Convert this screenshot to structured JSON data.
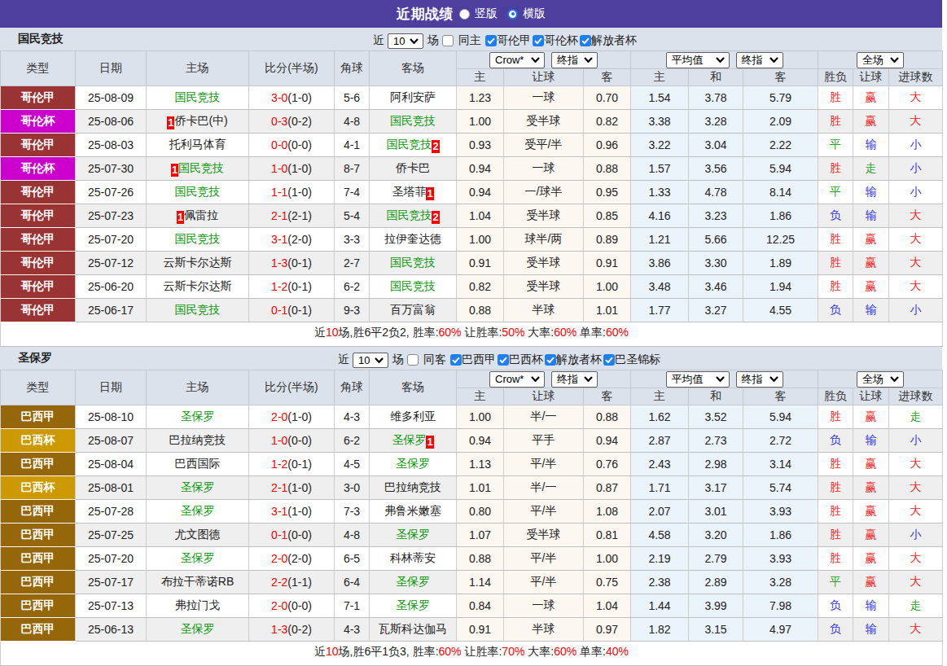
{
  "topbar": {
    "title": "近期战绩",
    "radios": [
      {
        "label": "竖版",
        "checked": false
      },
      {
        "label": "横版",
        "checked": true
      }
    ]
  },
  "colors": {
    "topbar_bg": "#4e3f9e",
    "bar_bg": "#dbe2ec",
    "header_bg": "#dbe2ec",
    "row_alt_bg": "#efefef",
    "odds_bg": "#fcf7f0",
    "avg_bg": "#ebf4fa",
    "team_green": "#008000",
    "score_red": "#e60000",
    "result_red": "#ee3333",
    "result_blue": "#3333dd",
    "result_green": "#2e9e2e",
    "badge_red": "#ff0000",
    "checkbox_blue": "#1e80f0",
    "league_colors": {
      "哥伦甲": "#9a3334",
      "哥伦杯": "#cc00cc",
      "巴西甲": "#96660a",
      "巴西杯": "#cc9900"
    }
  },
  "table_headers": {
    "left": [
      "类型",
      "日期",
      "主场",
      "比分(半场)",
      "角球",
      "客场"
    ],
    "sub": [
      "主",
      "让球",
      "客",
      "主",
      "和",
      "客",
      "胜负",
      "让球",
      "进球数"
    ],
    "selects": {
      "company": "Crow*",
      "company_time": "终指",
      "average": "平均值",
      "average_time": "终指",
      "scope": "全场"
    }
  },
  "sections": [
    {
      "team": "国民竞技",
      "controls": {
        "near": "近",
        "count": "10",
        "games": "场",
        "same": {
          "label": "同主",
          "checked": false
        },
        "leagues": [
          {
            "label": "哥伦甲",
            "checked": true
          },
          {
            "label": "哥伦杯",
            "checked": true
          },
          {
            "label": "解放者杯",
            "checked": true
          }
        ]
      },
      "rows": [
        {
          "type": "哥伦甲",
          "date": "25-08-09",
          "home": {
            "text": "国民竞技",
            "green": true
          },
          "score": {
            "ft": "3-0",
            "ht": "(1-0)"
          },
          "corner": "5-6",
          "away": {
            "text": "阿利安萨",
            "green": false
          },
          "odds": [
            "1.23",
            "一球",
            "0.70"
          ],
          "avg": [
            "1.54",
            "3.78",
            "5.79"
          ],
          "results": [
            [
              "胜",
              "r"
            ],
            [
              "赢",
              "r"
            ],
            [
              "大",
              "r"
            ]
          ]
        },
        {
          "type": "哥伦杯",
          "date": "25-08-06",
          "home": {
            "text": "侨卡巴(中)",
            "green": false,
            "badge": "1",
            "badge_pos": "before"
          },
          "score": {
            "ft": "0-3",
            "ht": "(0-2)"
          },
          "corner": "4-8",
          "away": {
            "text": "国民竞技",
            "green": true
          },
          "odds": [
            "1.00",
            "受半球",
            "0.82"
          ],
          "avg": [
            "3.38",
            "3.28",
            "2.09"
          ],
          "results": [
            [
              "胜",
              "r"
            ],
            [
              "赢",
              "r"
            ],
            [
              "大",
              "r"
            ]
          ]
        },
        {
          "type": "哥伦甲",
          "date": "25-08-03",
          "home": {
            "text": "托利马体育",
            "green": false
          },
          "score": {
            "ft": "0-0",
            "ht": "(0-0)"
          },
          "corner": "4-1",
          "away": {
            "text": "国民竞技",
            "green": true,
            "badge": "2",
            "badge_pos": "after"
          },
          "odds": [
            "0.93",
            "受平/半",
            "0.96"
          ],
          "avg": [
            "3.22",
            "3.04",
            "2.22"
          ],
          "results": [
            [
              "平",
              "g"
            ],
            [
              "输",
              "b"
            ],
            [
              "小",
              "b"
            ]
          ]
        },
        {
          "type": "哥伦杯",
          "date": "25-07-30",
          "home": {
            "text": "国民竞技",
            "green": true,
            "badge": "1",
            "badge_pos": "before"
          },
          "score": {
            "ft": "1-0",
            "ht": "(1-0)"
          },
          "corner": "8-7",
          "away": {
            "text": "侨卡巴",
            "green": false
          },
          "odds": [
            "0.94",
            "一球",
            "0.88"
          ],
          "avg": [
            "1.57",
            "3.56",
            "5.94"
          ],
          "results": [
            [
              "胜",
              "r"
            ],
            [
              "走",
              "g"
            ],
            [
              "小",
              "b"
            ]
          ]
        },
        {
          "type": "哥伦甲",
          "date": "25-07-26",
          "home": {
            "text": "国民竞技",
            "green": true
          },
          "score": {
            "ft": "1-1",
            "ht": "(1-0)"
          },
          "corner": "7-4",
          "away": {
            "text": "圣塔菲",
            "green": false,
            "badge": "1",
            "badge_pos": "after"
          },
          "odds": [
            "0.94",
            "一/球半",
            "0.95"
          ],
          "avg": [
            "1.33",
            "4.78",
            "8.14"
          ],
          "results": [
            [
              "平",
              "g"
            ],
            [
              "输",
              "b"
            ],
            [
              "小",
              "b"
            ]
          ]
        },
        {
          "type": "哥伦甲",
          "date": "25-07-23",
          "home": {
            "text": "佩雷拉",
            "green": false,
            "badge": "1",
            "badge_pos": "before"
          },
          "score": {
            "ft": "2-1",
            "ht": "(2-1)"
          },
          "corner": "5-4",
          "away": {
            "text": "国民竞技",
            "green": true,
            "badge": "2",
            "badge_pos": "after"
          },
          "odds": [
            "1.04",
            "受半球",
            "0.85"
          ],
          "avg": [
            "4.16",
            "3.23",
            "1.86"
          ],
          "results": [
            [
              "负",
              "b"
            ],
            [
              "输",
              "b"
            ],
            [
              "大",
              "r"
            ]
          ]
        },
        {
          "type": "哥伦甲",
          "date": "25-07-20",
          "home": {
            "text": "国民竞技",
            "green": true
          },
          "score": {
            "ft": "3-1",
            "ht": "(2-0)"
          },
          "corner": "3-3",
          "away": {
            "text": "拉伊奎达德",
            "green": false
          },
          "odds": [
            "1.00",
            "球半/两",
            "0.89"
          ],
          "avg": [
            "1.21",
            "5.66",
            "12.25"
          ],
          "results": [
            [
              "胜",
              "r"
            ],
            [
              "赢",
              "r"
            ],
            [
              "大",
              "r"
            ]
          ]
        },
        {
          "type": "哥伦甲",
          "date": "25-07-12",
          "home": {
            "text": "云斯卡尔达斯",
            "green": false
          },
          "score": {
            "ft": "1-3",
            "ht": "(0-1)"
          },
          "corner": "2-7",
          "away": {
            "text": "国民竞技",
            "green": true
          },
          "odds": [
            "0.91",
            "受半球",
            "0.91"
          ],
          "avg": [
            "3.86",
            "3.30",
            "1.89"
          ],
          "results": [
            [
              "胜",
              "r"
            ],
            [
              "赢",
              "r"
            ],
            [
              "大",
              "r"
            ]
          ]
        },
        {
          "type": "哥伦甲",
          "date": "25-06-20",
          "home": {
            "text": "云斯卡尔达斯",
            "green": false
          },
          "score": {
            "ft": "1-2",
            "ht": "(0-1)"
          },
          "corner": "6-2",
          "away": {
            "text": "国民竞技",
            "green": true
          },
          "odds": [
            "0.82",
            "受半球",
            "1.00"
          ],
          "avg": [
            "3.48",
            "3.46",
            "1.94"
          ],
          "results": [
            [
              "胜",
              "r"
            ],
            [
              "赢",
              "r"
            ],
            [
              "大",
              "r"
            ]
          ]
        },
        {
          "type": "哥伦甲",
          "date": "25-06-17",
          "home": {
            "text": "国民竞技",
            "green": true
          },
          "score": {
            "ft": "0-1",
            "ht": "(0-1)"
          },
          "corner": "9-3",
          "away": {
            "text": "百万富翁",
            "green": false
          },
          "odds": [
            "0.88",
            "半球",
            "1.01"
          ],
          "avg": [
            "1.77",
            "3.27",
            "4.55"
          ],
          "results": [
            [
              "负",
              "b"
            ],
            [
              "输",
              "b"
            ],
            [
              "小",
              "b"
            ]
          ]
        }
      ],
      "summary": [
        {
          "text": "近",
          "c": "k"
        },
        {
          "text": "10",
          "c": "r"
        },
        {
          "text": "场,胜6平2负2, 胜率:",
          "c": "k"
        },
        {
          "text": "60%",
          "c": "r"
        },
        {
          "text": " 让胜率:",
          "c": "k"
        },
        {
          "text": "50%",
          "c": "r"
        },
        {
          "text": " 大率:",
          "c": "k"
        },
        {
          "text": "60%",
          "c": "r"
        },
        {
          "text": " 单率:",
          "c": "k"
        },
        {
          "text": "60%",
          "c": "r"
        }
      ]
    },
    {
      "team": "圣保罗",
      "controls": {
        "near": "近",
        "count": "10",
        "games": "场",
        "same": {
          "label": "同客",
          "checked": false
        },
        "leagues": [
          {
            "label": "巴西甲",
            "checked": true
          },
          {
            "label": "巴西杯",
            "checked": true
          },
          {
            "label": "解放者杯",
            "checked": true
          },
          {
            "label": "巴圣锦标",
            "checked": true
          }
        ]
      },
      "rows": [
        {
          "type": "巴西甲",
          "date": "25-08-10",
          "home": {
            "text": "圣保罗",
            "green": true
          },
          "score": {
            "ft": "2-0",
            "ht": "(1-0)"
          },
          "corner": "4-3",
          "away": {
            "text": "维多利亚",
            "green": false
          },
          "odds": [
            "1.00",
            "半/一",
            "0.88"
          ],
          "avg": [
            "1.62",
            "3.52",
            "5.94"
          ],
          "results": [
            [
              "胜",
              "r"
            ],
            [
              "赢",
              "r"
            ],
            [
              "走",
              "g"
            ]
          ]
        },
        {
          "type": "巴西杯",
          "date": "25-08-07",
          "home": {
            "text": "巴拉纳竞技",
            "green": false
          },
          "score": {
            "ft": "1-0",
            "ht": "(0-0)"
          },
          "corner": "6-2",
          "away": {
            "text": "圣保罗",
            "green": true,
            "badge": "1",
            "badge_pos": "after"
          },
          "odds": [
            "0.94",
            "平手",
            "0.94"
          ],
          "avg": [
            "2.87",
            "2.73",
            "2.72"
          ],
          "results": [
            [
              "负",
              "b"
            ],
            [
              "输",
              "b"
            ],
            [
              "小",
              "b"
            ]
          ]
        },
        {
          "type": "巴西甲",
          "date": "25-08-04",
          "home": {
            "text": "巴西国际",
            "green": false
          },
          "score": {
            "ft": "1-2",
            "ht": "(0-1)"
          },
          "corner": "4-5",
          "away": {
            "text": "圣保罗",
            "green": true
          },
          "odds": [
            "1.13",
            "平/半",
            "0.76"
          ],
          "avg": [
            "2.43",
            "2.98",
            "3.14"
          ],
          "results": [
            [
              "胜",
              "r"
            ],
            [
              "赢",
              "r"
            ],
            [
              "大",
              "r"
            ]
          ]
        },
        {
          "type": "巴西杯",
          "date": "25-08-01",
          "home": {
            "text": "圣保罗",
            "green": true
          },
          "score": {
            "ft": "2-1",
            "ht": "(1-0)"
          },
          "corner": "3-0",
          "away": {
            "text": "巴拉纳竞技",
            "green": false
          },
          "odds": [
            "1.01",
            "半/一",
            "0.87"
          ],
          "avg": [
            "1.71",
            "3.17",
            "5.74"
          ],
          "results": [
            [
              "胜",
              "r"
            ],
            [
              "赢",
              "r"
            ],
            [
              "大",
              "r"
            ]
          ]
        },
        {
          "type": "巴西甲",
          "date": "25-07-28",
          "home": {
            "text": "圣保罗",
            "green": true
          },
          "score": {
            "ft": "3-1",
            "ht": "(1-0)"
          },
          "corner": "7-3",
          "away": {
            "text": "弗鲁米嫩塞",
            "green": false
          },
          "odds": [
            "0.80",
            "平/半",
            "1.08"
          ],
          "avg": [
            "2.07",
            "3.01",
            "3.93"
          ],
          "results": [
            [
              "胜",
              "r"
            ],
            [
              "赢",
              "r"
            ],
            [
              "大",
              "r"
            ]
          ]
        },
        {
          "type": "巴西甲",
          "date": "25-07-25",
          "home": {
            "text": "尤文图德",
            "green": false
          },
          "score": {
            "ft": "0-1",
            "ht": "(0-0)"
          },
          "corner": "4-8",
          "away": {
            "text": "圣保罗",
            "green": true
          },
          "odds": [
            "1.07",
            "受半球",
            "0.81"
          ],
          "avg": [
            "4.58",
            "3.20",
            "1.86"
          ],
          "results": [
            [
              "胜",
              "r"
            ],
            [
              "赢",
              "r"
            ],
            [
              "小",
              "b"
            ]
          ]
        },
        {
          "type": "巴西甲",
          "date": "25-07-20",
          "home": {
            "text": "圣保罗",
            "green": true
          },
          "score": {
            "ft": "2-0",
            "ht": "(2-0)"
          },
          "corner": "6-5",
          "away": {
            "text": "科林蒂安",
            "green": false
          },
          "odds": [
            "0.88",
            "平/半",
            "1.00"
          ],
          "avg": [
            "2.19",
            "2.79",
            "3.93"
          ],
          "results": [
            [
              "胜",
              "r"
            ],
            [
              "赢",
              "r"
            ],
            [
              "大",
              "r"
            ]
          ]
        },
        {
          "type": "巴西甲",
          "date": "25-07-17",
          "home": {
            "text": "布拉干蒂诺RB",
            "green": false
          },
          "score": {
            "ft": "2-2",
            "ht": "(1-1)"
          },
          "corner": "6-4",
          "away": {
            "text": "圣保罗",
            "green": true
          },
          "odds": [
            "1.14",
            "平/半",
            "0.75"
          ],
          "avg": [
            "2.38",
            "2.89",
            "3.28"
          ],
          "results": [
            [
              "平",
              "g"
            ],
            [
              "赢",
              "r"
            ],
            [
              "大",
              "r"
            ]
          ]
        },
        {
          "type": "巴西甲",
          "date": "25-07-13",
          "home": {
            "text": "弗拉门戈",
            "green": false
          },
          "score": {
            "ft": "2-0",
            "ht": "(0-0)"
          },
          "corner": "7-1",
          "away": {
            "text": "圣保罗",
            "green": true
          },
          "odds": [
            "0.84",
            "一球",
            "1.04"
          ],
          "avg": [
            "1.44",
            "3.99",
            "7.98"
          ],
          "results": [
            [
              "负",
              "b"
            ],
            [
              "输",
              "b"
            ],
            [
              "走",
              "g"
            ]
          ]
        },
        {
          "type": "巴西甲",
          "date": "25-06-13",
          "home": {
            "text": "圣保罗",
            "green": true
          },
          "score": {
            "ft": "1-3",
            "ht": "(0-2)"
          },
          "corner": "4-3",
          "away": {
            "text": "瓦斯科达伽马",
            "green": false
          },
          "odds": [
            "0.91",
            "半球",
            "0.97"
          ],
          "avg": [
            "1.82",
            "3.15",
            "4.97"
          ],
          "results": [
            [
              "负",
              "b"
            ],
            [
              "输",
              "b"
            ],
            [
              "大",
              "r"
            ]
          ]
        }
      ],
      "summary": [
        {
          "text": "近",
          "c": "k"
        },
        {
          "text": "10",
          "c": "r"
        },
        {
          "text": "场,胜6平1负3, 胜率:",
          "c": "k"
        },
        {
          "text": "60%",
          "c": "r"
        },
        {
          "text": " 让胜率:",
          "c": "k"
        },
        {
          "text": "70%",
          "c": "r"
        },
        {
          "text": " 大率:",
          "c": "k"
        },
        {
          "text": "60%",
          "c": "r"
        },
        {
          "text": " 单率:",
          "c": "k"
        },
        {
          "text": "40%",
          "c": "r"
        }
      ]
    }
  ]
}
